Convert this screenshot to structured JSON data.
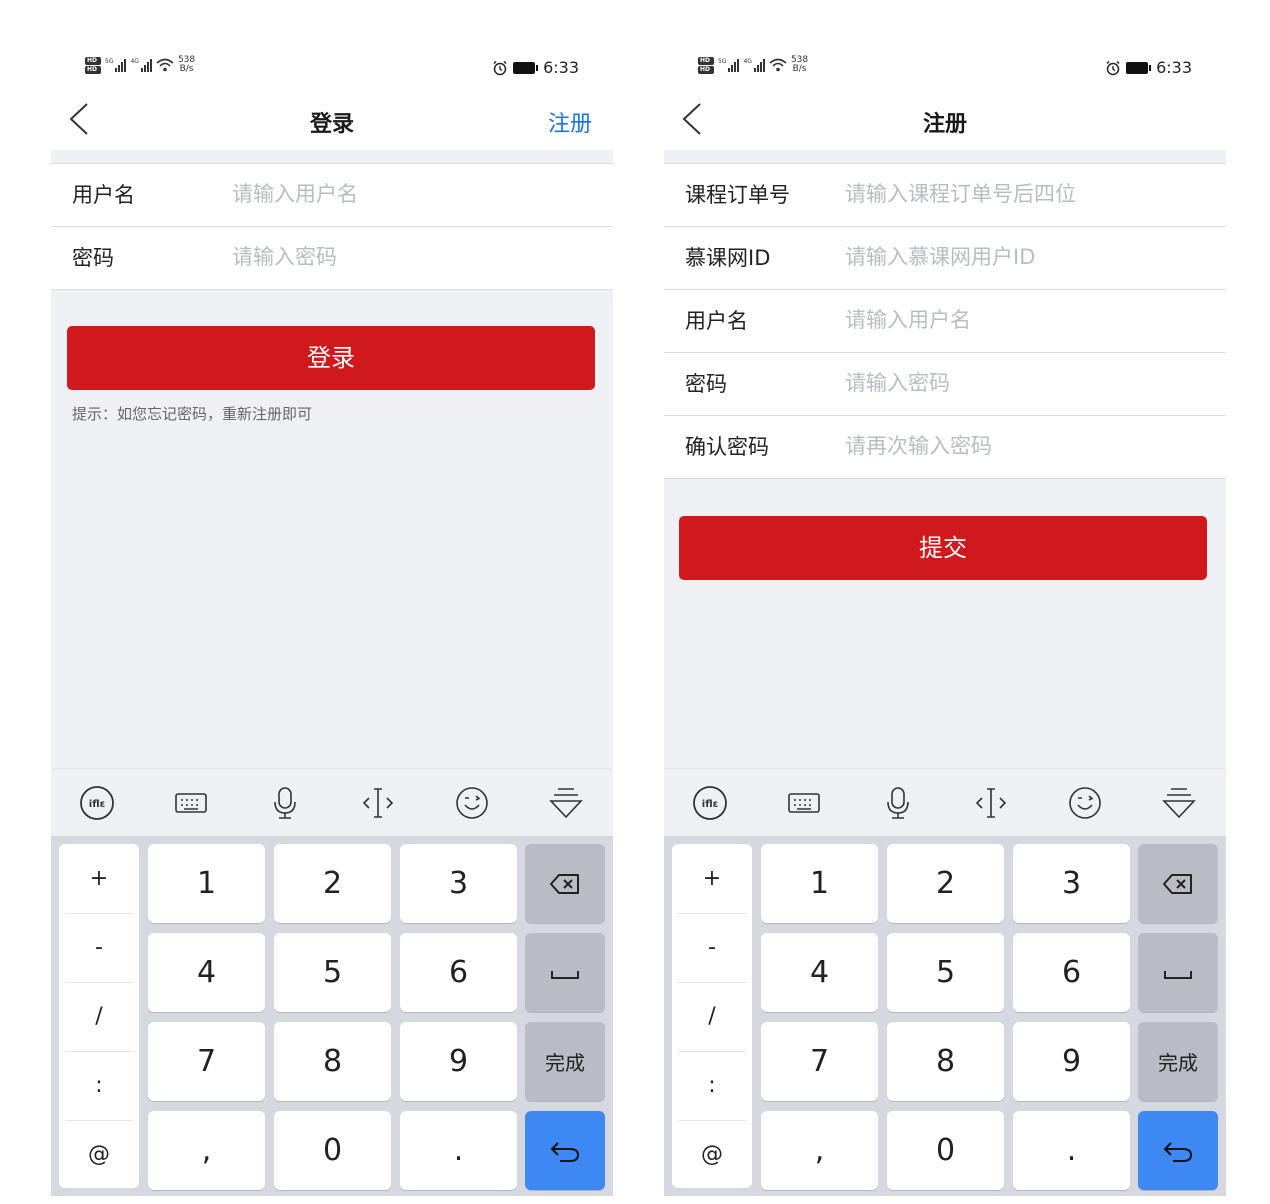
{
  "status_bar": {
    "network_left": "HD",
    "network_right": "HD",
    "sim1": "5G",
    "sim2": "4G",
    "speed_value": "538",
    "speed_unit": "B/s",
    "time": "6:33"
  },
  "login": {
    "title": "登录",
    "right_action": "注册",
    "fields": [
      {
        "label": "用户名",
        "placeholder": "请输入用户名",
        "value": ""
      },
      {
        "label": "密码",
        "placeholder": "请输入密码",
        "value": ""
      }
    ],
    "submit_label": "登录",
    "hint": "提示：如您忘记密码，重新注册即可"
  },
  "register": {
    "title": "注册",
    "fields": [
      {
        "label": "课程订单号",
        "placeholder": "请输入课程订单号后四位",
        "value": ""
      },
      {
        "label": "慕课网ID",
        "placeholder": "请输入慕课网用户ID",
        "value": ""
      },
      {
        "label": "用户名",
        "placeholder": "请输入用户名",
        "value": ""
      },
      {
        "label": "密码",
        "placeholder": "请输入密码",
        "value": ""
      },
      {
        "label": "确认密码",
        "placeholder": "请再次输入密码",
        "value": ""
      }
    ],
    "submit_label": "提交"
  },
  "keyboard": {
    "toolbar_icons": [
      "ime-logo-icon",
      "keyboard-icon",
      "microphone-icon",
      "cursor-icon",
      "emoji-icon",
      "hide-keyboard-icon"
    ],
    "symbols": [
      "+",
      "-",
      "/",
      ":",
      "@"
    ],
    "digits": [
      "1",
      "2",
      "3",
      "4",
      "5",
      "6",
      "7",
      "8",
      "9",
      ",",
      "0",
      "."
    ],
    "done_label": "完成",
    "accent_color": "#3d88f2",
    "button_color": "#d0191c"
  }
}
